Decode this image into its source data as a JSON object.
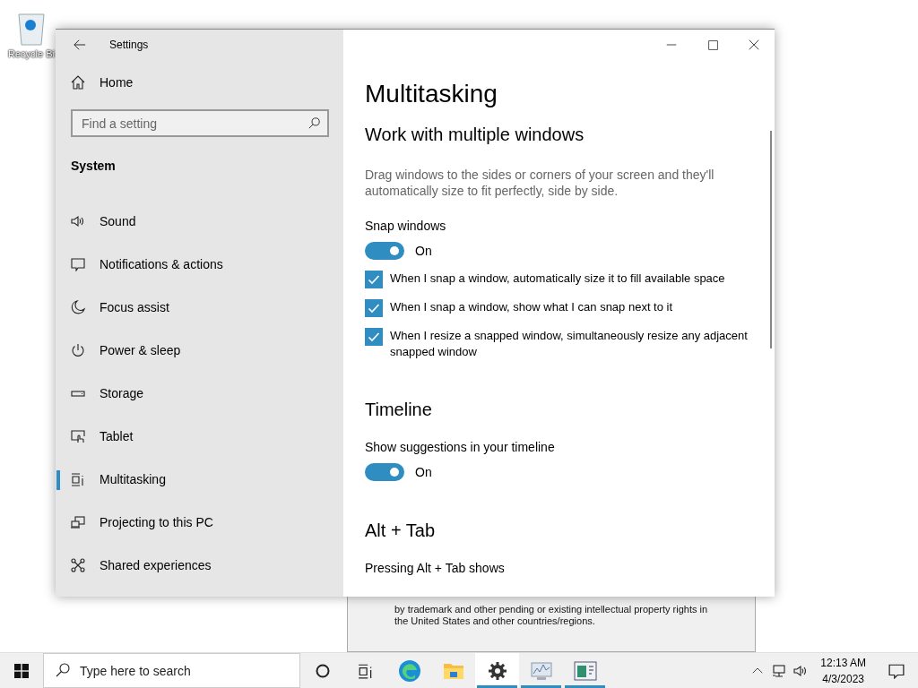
{
  "desktop_icons": [
    {
      "label": "Recycle Bi"
    }
  ],
  "background_window": {
    "text": "by trademark and other pending or existing intellectual property rights in the United States and other countries/regions."
  },
  "settings": {
    "title": "Settings",
    "home": "Home",
    "search": {
      "placeholder": "Find a setting"
    },
    "group": "System",
    "nav_items": [
      {
        "label": "Sound",
        "selected": false
      },
      {
        "label": "Notifications & actions",
        "selected": false
      },
      {
        "label": "Focus assist",
        "selected": false
      },
      {
        "label": "Power & sleep",
        "selected": false
      },
      {
        "label": "Storage",
        "selected": false
      },
      {
        "label": "Tablet",
        "selected": false
      },
      {
        "label": "Multitasking",
        "selected": true
      },
      {
        "label": "Projecting to this PC",
        "selected": false
      },
      {
        "label": "Shared experiences",
        "selected": false
      }
    ],
    "page_title": "Multitasking",
    "sections": [
      {
        "heading": "Work with multiple windows",
        "items": [
          {
            "kind": "description",
            "text": "Drag windows to the sides or corners of your screen and they'll automatically size to fit perfectly, side by side."
          },
          {
            "kind": "label",
            "text": "Snap windows"
          },
          {
            "kind": "toggle",
            "on": true,
            "text": "On"
          },
          {
            "kind": "checkbox",
            "checked": true,
            "text": "When I snap a window, automatically size it to fill available space"
          },
          {
            "kind": "checkbox",
            "checked": true,
            "text": "When I snap a window, show what I can snap next to it"
          },
          {
            "kind": "checkbox",
            "checked": true,
            "text": "When I resize a snapped window, simultaneously resize any adjacent snapped window"
          }
        ]
      },
      {
        "heading": "Timeline",
        "items": [
          {
            "kind": "label",
            "text": "Show suggestions in your timeline"
          },
          {
            "kind": "toggle",
            "on": true,
            "text": "On"
          }
        ]
      },
      {
        "heading": "Alt + Tab",
        "items": [
          {
            "kind": "label",
            "text": "Pressing Alt + Tab shows"
          }
        ]
      }
    ]
  },
  "taskbar": {
    "search": {
      "placeholder": "Type here to search"
    },
    "apps": [
      {
        "running": false,
        "selected": false
      },
      {
        "running": false,
        "selected": false
      },
      {
        "running": true,
        "selected": true
      },
      {
        "running": true,
        "selected": false
      },
      {
        "running": true,
        "selected": false
      }
    ],
    "time": "12:13 AM",
    "date": "4/3/2023"
  }
}
